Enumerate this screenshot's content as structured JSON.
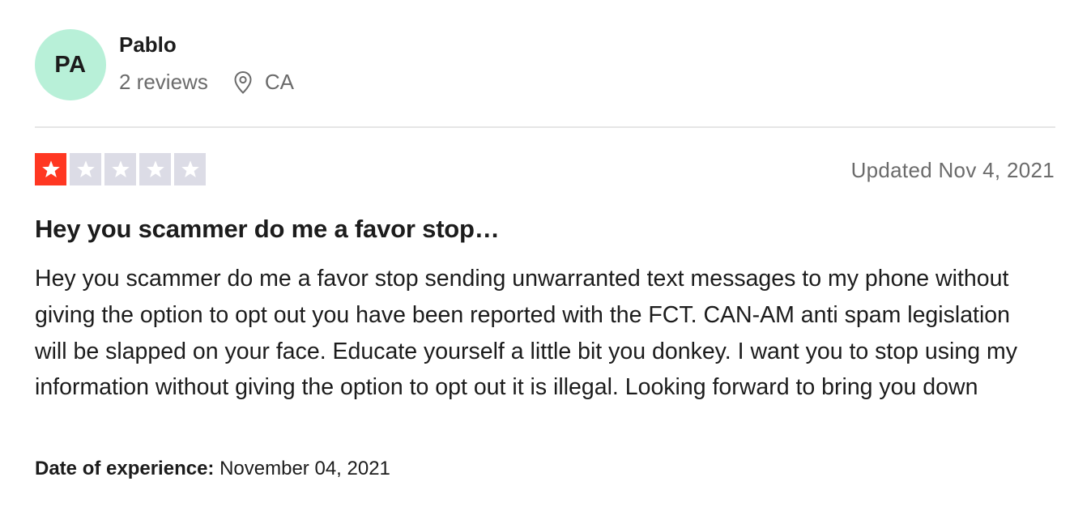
{
  "consumer": {
    "initials": "PA",
    "avatar_color": "#b8f0d8",
    "name": "Pablo",
    "reviews_count": "2 reviews",
    "location_icon": "location-pin-icon",
    "location": "CA"
  },
  "review": {
    "rating": 1,
    "rating_max": 5,
    "filled_star_color": "#ff3722",
    "empty_star_color": "#dcdce6",
    "date": "Updated Nov 4, 2021",
    "title": "Hey you scammer do me a favor stop…",
    "body": "Hey you scammer do me a favor stop sending unwarranted text messages to my phone without giving the option to opt out you have been reported with the FCT. CAN-AM anti spam legislation will be slapped on your face. Educate yourself a little bit you donkey. I want you to stop using my information without giving the option to opt out it is illegal. Looking forward to bring you down",
    "experience_label": "Date of experience:",
    "experience_date": "November 04, 2021"
  }
}
